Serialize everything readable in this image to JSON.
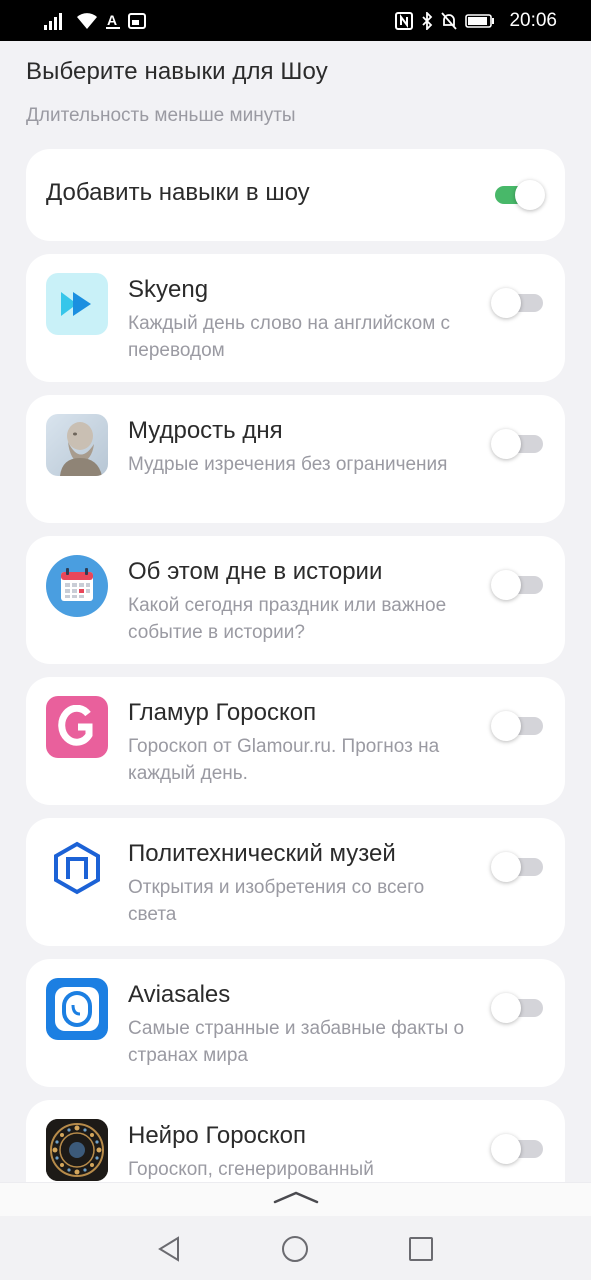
{
  "status_bar": {
    "time": "20:06",
    "left_icons": [
      "signal-icon",
      "wifi-icon",
      "font-a-icon",
      "window-icon"
    ],
    "right_icons": [
      "nfc-icon",
      "bluetooth-icon",
      "mute-bell-icon",
      "battery-icon"
    ]
  },
  "header": {
    "title": "Выберите навыки для Шоу",
    "subtitle": "Длительность меньше минуты"
  },
  "master_toggle": {
    "label": "Добавить навыки в шоу",
    "on": true
  },
  "skills": [
    {
      "name": "Skyeng",
      "description": "Каждый день слово на английском с переводом",
      "icon": "skyeng-play-icon",
      "on": false
    },
    {
      "name": "Мудрость дня",
      "description": "Мудрые изречения без ограничения",
      "icon": "philosopher-bust-icon",
      "on": false
    },
    {
      "name": "Об этом дне в истории",
      "description": "Какой сегодня праздник или важное событие в истории?",
      "icon": "calendar-icon",
      "on": false
    },
    {
      "name": "Гламур Гороскоп",
      "description": "Гороскоп от Glamour.ru. Прогноз на каждый день.",
      "icon": "glamour-g-icon",
      "on": false
    },
    {
      "name": "Политехнический музей",
      "description": "Открытия и изобретения со всего света",
      "icon": "polytech-hexagon-icon",
      "on": false
    },
    {
      "name": "Aviasales",
      "description": "Самые странные и забавные факты о странах мира",
      "icon": "aviasales-window-icon",
      "on": false
    },
    {
      "name": "Нейро Гороскоп",
      "description": "Гороскоп, сгенерированный",
      "icon": "zodiac-wheel-icon",
      "on": false
    }
  ],
  "colors": {
    "toggle_on": "#48b869",
    "toggle_off": "#d4d4d9",
    "secondary_text": "#9a9aa2",
    "background": "#f2f2f5"
  }
}
